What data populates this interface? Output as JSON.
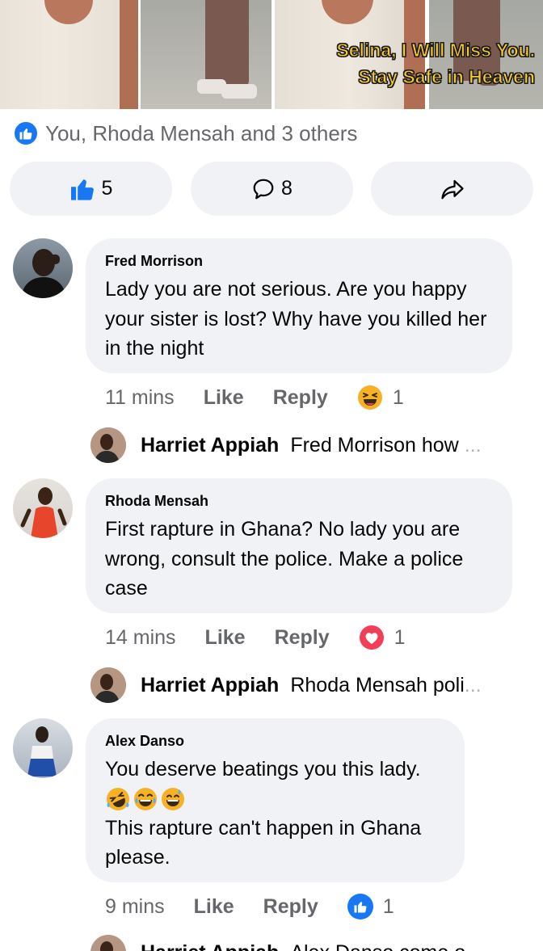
{
  "post": {
    "image_caption_line1": "Selina, I Will Miss You.",
    "image_caption_line2": "Stay Safe in Heaven",
    "reaction_summary": "You, Rhoda Mensah and 3 others",
    "actions": {
      "like_count": "5",
      "comment_count": "8"
    }
  },
  "comments": [
    {
      "author": "Fred Morrison",
      "text": "Lady you are not serious. Are you happy your sister is lost? Why have you killed her in the night",
      "time": "11 mins",
      "like_label": "Like",
      "reply_label": "Reply",
      "reaction": "haha",
      "reaction_count": "1",
      "reply_preview": {
        "author": "Harriet Appiah",
        "text": "Fred Morrison how",
        "ellipsis": "..."
      }
    },
    {
      "author": "Rhoda Mensah",
      "text": "First rapture in Ghana? No lady you are wrong, consult the police. Make a police case",
      "time": "14 mins",
      "like_label": "Like",
      "reply_label": "Reply",
      "reaction": "love",
      "reaction_count": "1",
      "reply_preview": {
        "author": "Harriet Appiah",
        "text": "Rhoda Mensah poli",
        "ellipsis": "..."
      }
    },
    {
      "author": "Alex Danso",
      "text_line1": "You deserve beatings you this lady.",
      "emojis": [
        "rolling-laughing",
        "crying-laughing",
        "grinning-sweat"
      ],
      "text_line2": "This rapture can't happen in Ghana please.",
      "time": "9 mins",
      "like_label": "Like",
      "reply_label": "Reply",
      "reaction": "like",
      "reaction_count": "1",
      "reply_preview": {
        "author": "Harriet Appiah",
        "text": "Alex Danso come o"
      }
    }
  ],
  "colors": {
    "facebook_blue": "#1877f2",
    "bubble_bg": "#f0f2f5",
    "meta_gray": "#65676b",
    "love_red": "#f33e58",
    "haha_yellow": "#f7b125",
    "caption_yellow": "#f7c92f"
  }
}
